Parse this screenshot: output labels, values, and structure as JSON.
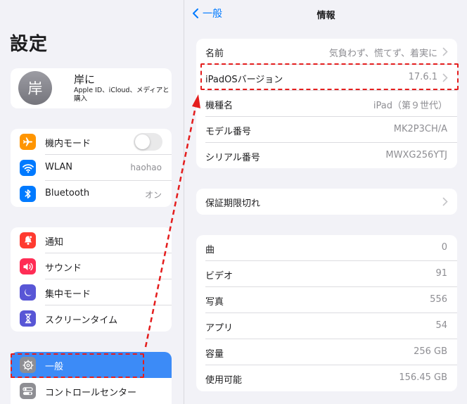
{
  "sidebar": {
    "title": "設定",
    "profile": {
      "avatar_text": "岸",
      "name": "岸に",
      "subtitle": "Apple ID、iCloud、メディアと購入"
    },
    "group1": [
      {
        "label": "機内モード",
        "icon": "airplane-icon",
        "color": "#ff9500",
        "toggle": false
      },
      {
        "label": "WLAN",
        "icon": "wifi-icon",
        "color": "#007aff",
        "value": "haohao"
      },
      {
        "label": "Bluetooth",
        "icon": "bluetooth-icon",
        "color": "#007aff",
        "value": "オン"
      }
    ],
    "group2": [
      {
        "label": "通知",
        "icon": "bell-icon",
        "color": "#ff3b30"
      },
      {
        "label": "サウンド",
        "icon": "speaker-icon",
        "color": "#ff2d55"
      },
      {
        "label": "集中モード",
        "icon": "moon-icon",
        "color": "#5856d6"
      },
      {
        "label": "スクリーンタイム",
        "icon": "hourglass-icon",
        "color": "#5856d6"
      }
    ],
    "group3": [
      {
        "label": "一般",
        "icon": "gear-icon",
        "color": "#8e8e93",
        "selected": true
      },
      {
        "label": "コントロールセンター",
        "icon": "switches-icon",
        "color": "#8e8e93"
      }
    ]
  },
  "main": {
    "back_label": "一般",
    "nav_title": "情報",
    "section1": [
      {
        "label": "名前",
        "value": "気負わず、慌てず、着実に",
        "chevron": true
      },
      {
        "label": "iPadOSバージョン",
        "value": "17.6.1",
        "chevron": true
      },
      {
        "label": "機種名",
        "value": "iPad（第９世代）"
      },
      {
        "label": "モデル番号",
        "value": "MK2P3CH/A"
      },
      {
        "label": "シリアル番号",
        "value": "MWXG256YTJ"
      }
    ],
    "section2": [
      {
        "label": "保証期限切れ",
        "chevron": true
      }
    ],
    "section3": [
      {
        "label": "曲",
        "value": "0"
      },
      {
        "label": "ビデオ",
        "value": "91"
      },
      {
        "label": "写真",
        "value": "556"
      },
      {
        "label": "アプリ",
        "value": "54"
      },
      {
        "label": "容量",
        "value": "256 GB"
      },
      {
        "label": "使用可能",
        "value": "156.45 GB"
      }
    ]
  },
  "annotation": {
    "color": "#e41d1d"
  }
}
